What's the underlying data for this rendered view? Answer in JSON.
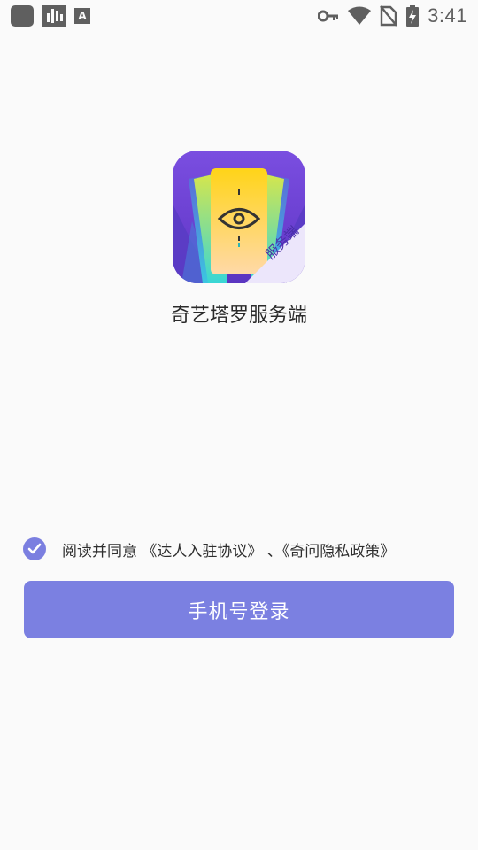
{
  "status_bar": {
    "time": "3:41",
    "icons": [
      "app-square-icon",
      "bars-icon",
      "font-a-icon",
      "key-icon",
      "wifi-icon",
      "no-sim-icon",
      "battery-charging-icon"
    ],
    "a_glyph": "A"
  },
  "app": {
    "name": "奇艺塔罗服务端",
    "badge": "服务端",
    "colors": {
      "background": "#6a3fd0",
      "card": "#ffd21e",
      "accent": "#7b80e1"
    }
  },
  "agreement": {
    "checked": true,
    "prefix": "阅读并同意 ",
    "link1": "《达人入驻协议》",
    "separator": " 、",
    "link2": "《奇问隐私政策》"
  },
  "login": {
    "label": "手机号登录"
  }
}
